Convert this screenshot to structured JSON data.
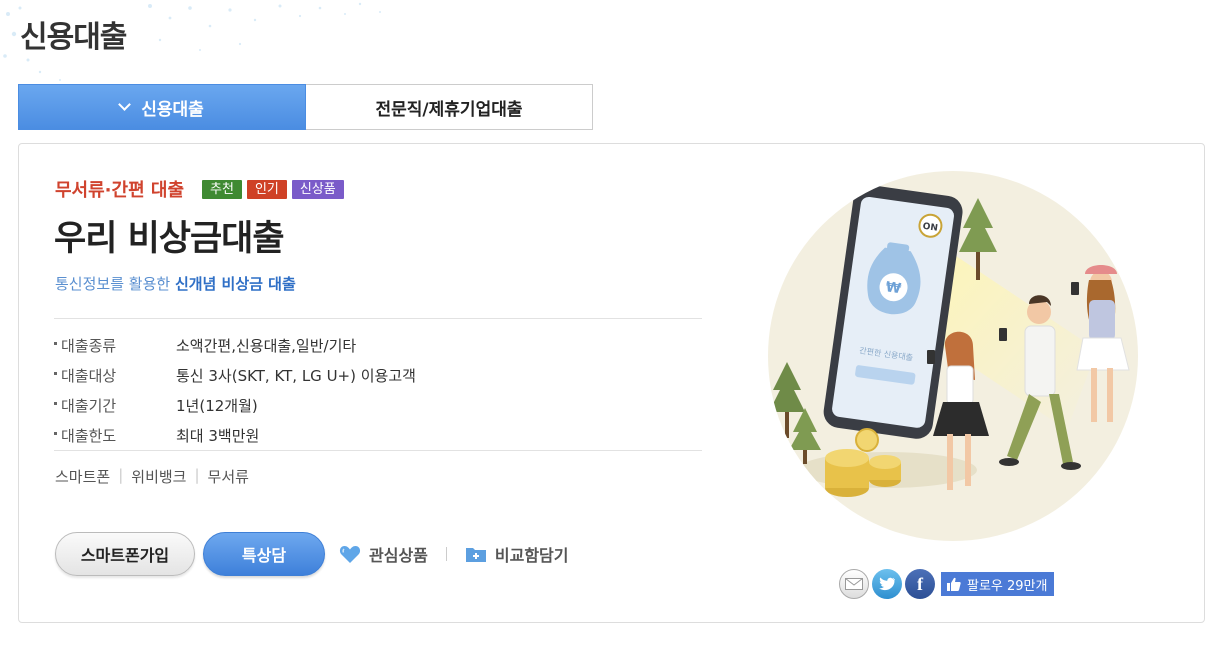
{
  "page": {
    "title": "신용대출"
  },
  "tabs": [
    {
      "label": "신용대출",
      "active": true
    },
    {
      "label": "전문직/제휴기업대출",
      "active": false
    }
  ],
  "product": {
    "category": "무서류·간편 대출",
    "tags": [
      "추천",
      "인기",
      "신상품"
    ],
    "name": "우리 비상금대출",
    "desc_prefix": "통신정보를 활용한 ",
    "desc_bold": "신개념 비상금 대출",
    "info": [
      {
        "key": "대출종류",
        "value": "소액간편,신용대출,일반/기타"
      },
      {
        "key": "대출대상",
        "value": "통신 3사(SKT, KT, LG U+) 이용고객"
      },
      {
        "key": "대출기간",
        "value": "1년(12개월)"
      },
      {
        "key": "대출한도",
        "value": "최대 3백만원"
      }
    ],
    "keywords": [
      "스마트폰",
      "위비뱅크",
      "무서류"
    ]
  },
  "actions": {
    "apply_label": "스마트폰가입",
    "consult_label": "특상담",
    "favorite_label": "관심상품",
    "compare_label": "비교함담기"
  },
  "illustration": {
    "phone_on_label": "ON",
    "phone_caption": "간편한 신용대출"
  },
  "social": {
    "like_label": "팔로우 29만개"
  },
  "colors": {
    "accent_blue": "#4b8de2",
    "category_red": "#d0432e",
    "tag_green": "#3f8a32",
    "tag_red": "#cf4126",
    "tag_purple": "#7a5bc9"
  }
}
